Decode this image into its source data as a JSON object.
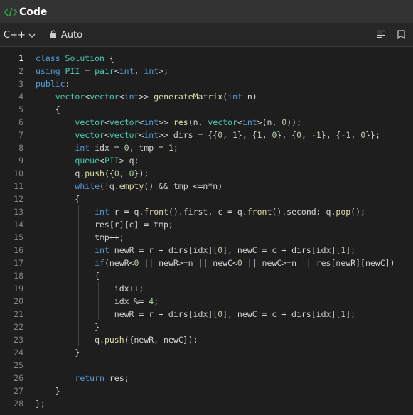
{
  "header": {
    "title": "Code",
    "icon": "code-icon"
  },
  "toolbar": {
    "language": "C++",
    "mode": "Auto",
    "icons": [
      "chevron-down-icon",
      "lock-icon",
      "format-icon",
      "bookmark-icon"
    ]
  },
  "colors": {
    "background": "#1e1e1e",
    "header": "#333333",
    "keyword": "#569cd6",
    "type": "#4ec9b0",
    "function": "#dcdcaa",
    "number": "#b5cea8",
    "code_icon": "#2ea043"
  },
  "editor": {
    "current_line": 1,
    "lines": [
      [
        [
          "class ",
          "kw"
        ],
        [
          "Solution ",
          "ty"
        ],
        [
          "{",
          ""
        ]
      ],
      [
        [
          "using ",
          "kw"
        ],
        [
          "PII ",
          "ty"
        ],
        [
          "= ",
          ""
        ],
        [
          "pair",
          "ty"
        ],
        [
          "<",
          ""
        ],
        [
          "int",
          "kw"
        ],
        [
          ", ",
          ""
        ],
        [
          "int",
          "kw"
        ],
        [
          ">;",
          ""
        ]
      ],
      [
        [
          "public",
          "kw"
        ],
        [
          ":",
          ""
        ]
      ],
      [
        [
          "    ",
          ""
        ],
        [
          "vector",
          "ty"
        ],
        [
          "<",
          ""
        ],
        [
          "vector",
          "ty"
        ],
        [
          "<",
          ""
        ],
        [
          "int",
          "kw"
        ],
        [
          ">> ",
          ""
        ],
        [
          "generateMatrix",
          "fn"
        ],
        [
          "(",
          ""
        ],
        [
          "int ",
          "kw"
        ],
        [
          "n)",
          ""
        ]
      ],
      [
        [
          "    {",
          ""
        ]
      ],
      [
        [
          "        ",
          ""
        ],
        [
          "vector",
          "ty"
        ],
        [
          "<",
          ""
        ],
        [
          "vector",
          "ty"
        ],
        [
          "<",
          ""
        ],
        [
          "int",
          "kw"
        ],
        [
          ">> ",
          ""
        ],
        [
          "res",
          "fn"
        ],
        [
          "(n, ",
          ""
        ],
        [
          "vector",
          "ty"
        ],
        [
          "<",
          ""
        ],
        [
          "int",
          "kw"
        ],
        [
          ">(n, ",
          ""
        ],
        [
          "0",
          "nm"
        ],
        [
          "));",
          ""
        ]
      ],
      [
        [
          "        ",
          ""
        ],
        [
          "vector",
          "ty"
        ],
        [
          "<",
          ""
        ],
        [
          "vector",
          "ty"
        ],
        [
          "<",
          ""
        ],
        [
          "int",
          "kw"
        ],
        [
          ">> dirs = {{",
          ""
        ],
        [
          "0",
          "nm"
        ],
        [
          ", ",
          ""
        ],
        [
          "1",
          "nm"
        ],
        [
          "}, {",
          ""
        ],
        [
          "1",
          "nm"
        ],
        [
          ", ",
          ""
        ],
        [
          "0",
          "nm"
        ],
        [
          "}, {",
          ""
        ],
        [
          "0",
          "nm"
        ],
        [
          ", ",
          ""
        ],
        [
          "-1",
          "nm"
        ],
        [
          "}, {",
          ""
        ],
        [
          "-1",
          "nm"
        ],
        [
          ", ",
          ""
        ],
        [
          "0",
          "nm"
        ],
        [
          "}};",
          ""
        ]
      ],
      [
        [
          "        ",
          ""
        ],
        [
          "int ",
          "kw"
        ],
        [
          "idx = ",
          ""
        ],
        [
          "0",
          "nm"
        ],
        [
          ", tmp = ",
          ""
        ],
        [
          "1",
          "nm"
        ],
        [
          ";",
          ""
        ]
      ],
      [
        [
          "        ",
          ""
        ],
        [
          "queue",
          "ty"
        ],
        [
          "<",
          ""
        ],
        [
          "PII",
          "ty"
        ],
        [
          "> q;",
          ""
        ]
      ],
      [
        [
          "        q.",
          ""
        ],
        [
          "push",
          "fn"
        ],
        [
          "({",
          ""
        ],
        [
          "0",
          "nm"
        ],
        [
          ", ",
          ""
        ],
        [
          "0",
          "nm"
        ],
        [
          "});",
          ""
        ]
      ],
      [
        [
          "        ",
          ""
        ],
        [
          "while",
          "kw"
        ],
        [
          "(!q.",
          ""
        ],
        [
          "empty",
          "fn"
        ],
        [
          "() && tmp <=n*n)",
          ""
        ]
      ],
      [
        [
          "        {",
          ""
        ]
      ],
      [
        [
          "            ",
          ""
        ],
        [
          "int ",
          "kw"
        ],
        [
          "r = q.",
          ""
        ],
        [
          "front",
          "fn"
        ],
        [
          "().first, c = q.",
          ""
        ],
        [
          "front",
          "fn"
        ],
        [
          "().second; q.",
          ""
        ],
        [
          "pop",
          "fn"
        ],
        [
          "();",
          ""
        ]
      ],
      [
        [
          "            res[r][c] = tmp;",
          ""
        ]
      ],
      [
        [
          "            tmp++;",
          ""
        ]
      ],
      [
        [
          "            ",
          ""
        ],
        [
          "int ",
          "kw"
        ],
        [
          "newR = r + dirs[idx][",
          ""
        ],
        [
          "0",
          "nm"
        ],
        [
          "], newC = c + dirs[idx][",
          ""
        ],
        [
          "1",
          "nm"
        ],
        [
          "];",
          ""
        ]
      ],
      [
        [
          "            ",
          ""
        ],
        [
          "if",
          "kw"
        ],
        [
          "(newR<",
          ""
        ],
        [
          "0",
          "nm"
        ],
        [
          " || newR>=n || newC<",
          ""
        ],
        [
          "0",
          "nm"
        ],
        [
          " || newC>=n || res[newR][newC])",
          ""
        ]
      ],
      [
        [
          "            {",
          ""
        ]
      ],
      [
        [
          "                idx++;",
          ""
        ]
      ],
      [
        [
          "                idx %= ",
          ""
        ],
        [
          "4",
          "nm"
        ],
        [
          ";",
          ""
        ]
      ],
      [
        [
          "                newR = r + dirs[idx][",
          ""
        ],
        [
          "0",
          "nm"
        ],
        [
          "], newC = c + dirs[idx][",
          ""
        ],
        [
          "1",
          "nm"
        ],
        [
          "];",
          ""
        ]
      ],
      [
        [
          "            }",
          ""
        ]
      ],
      [
        [
          "            q.",
          ""
        ],
        [
          "push",
          "fn"
        ],
        [
          "({newR, newC});",
          ""
        ]
      ],
      [
        [
          "        }",
          ""
        ]
      ],
      [
        [
          "",
          ""
        ]
      ],
      [
        [
          "        ",
          ""
        ],
        [
          "return ",
          "kw"
        ],
        [
          "res;",
          ""
        ]
      ],
      [
        [
          "    }",
          ""
        ]
      ],
      [
        [
          "};",
          ""
        ]
      ]
    ]
  }
}
